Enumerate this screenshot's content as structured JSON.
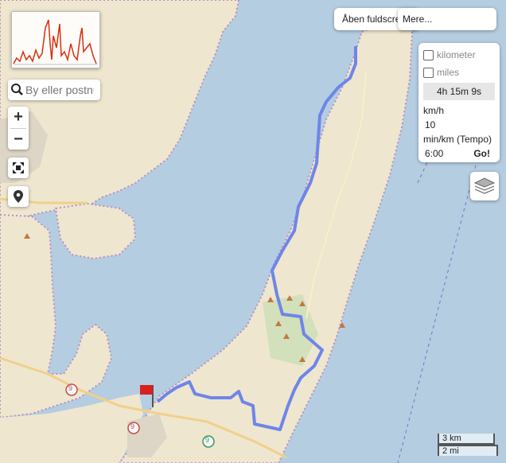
{
  "search": {
    "placeholder": "By eller postnummer"
  },
  "zoom": {
    "in_label": "+",
    "out_label": "−"
  },
  "buttons": {
    "open_fullscreen": "Åben fuldscreen",
    "more": "Mere..."
  },
  "panel": {
    "unit_km": "kilometer",
    "unit_miles": "miles",
    "duration": "4h 15m 9s",
    "speed_label": "km/h",
    "speed_value": "10",
    "pace_label": "min/km (Tempo)",
    "pace_value": "6:00",
    "go_label": "Go!"
  },
  "scale": {
    "km": "3 km",
    "mi": "2 mi"
  },
  "route_markers": {
    "route_number": "9"
  },
  "colors": {
    "route": "#6e86e8",
    "sea": "#b5cde0",
    "land": "#efe6d0",
    "profile_line": "#d83010"
  },
  "icons": [
    "search-icon",
    "fullscreen-icon",
    "location-pin-icon",
    "layers-icon",
    "start-flag-icon"
  ]
}
